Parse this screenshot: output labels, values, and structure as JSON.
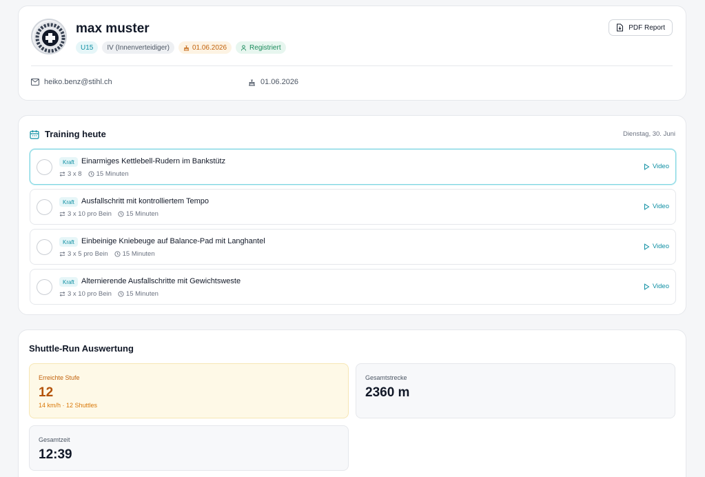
{
  "profile": {
    "name": "max muster",
    "badges": {
      "age_group": "U15",
      "position": "IV (Innenverteidiger)",
      "birthday": "01.06.2026",
      "status": "Registriert"
    },
    "pdf_button_label": "PDF Report",
    "email": "heiko.benz@stihl.ch",
    "birthdate": "01.06.2026"
  },
  "training": {
    "title": "Training heute",
    "date": "Dienstag, 30. Juni",
    "exercises": [
      {
        "tag": "Kraft",
        "title": "Einarmiges Kettlebell-Rudern im Bankstütz",
        "sets": "3 x 8",
        "duration": "15 Minuten",
        "video_label": "Video"
      },
      {
        "tag": "Kraft",
        "title": "Ausfallschritt mit kontrolliertem Tempo",
        "sets": "3 x 10 pro Bein",
        "duration": "15 Minuten",
        "video_label": "Video"
      },
      {
        "tag": "Kraft",
        "title": "Einbeinige Kniebeuge auf Balance-Pad mit Langhantel",
        "sets": "3 x 5 pro Bein",
        "duration": "15 Minuten",
        "video_label": "Video"
      },
      {
        "tag": "Kraft",
        "title": "Alternierende Ausfallschritte mit Gewichtsweste",
        "sets": "3 x 10 pro Bein",
        "duration": "15 Minuten",
        "video_label": "Video"
      }
    ]
  },
  "shuttle": {
    "title": "Shuttle-Run Auswertung",
    "level": {
      "label": "Erreichte Stufe",
      "value": "12",
      "sub": "14 km/h · 12 Shuttles"
    },
    "distance": {
      "label": "Gesamtstrecke",
      "value": "2360 m"
    },
    "time": {
      "label": "Gesamtzeit",
      "value": "12:39"
    }
  },
  "colors": {
    "accent": "#0e8fa3",
    "highlight_bg": "#fef9e7",
    "highlight_text": "#b4530a"
  }
}
